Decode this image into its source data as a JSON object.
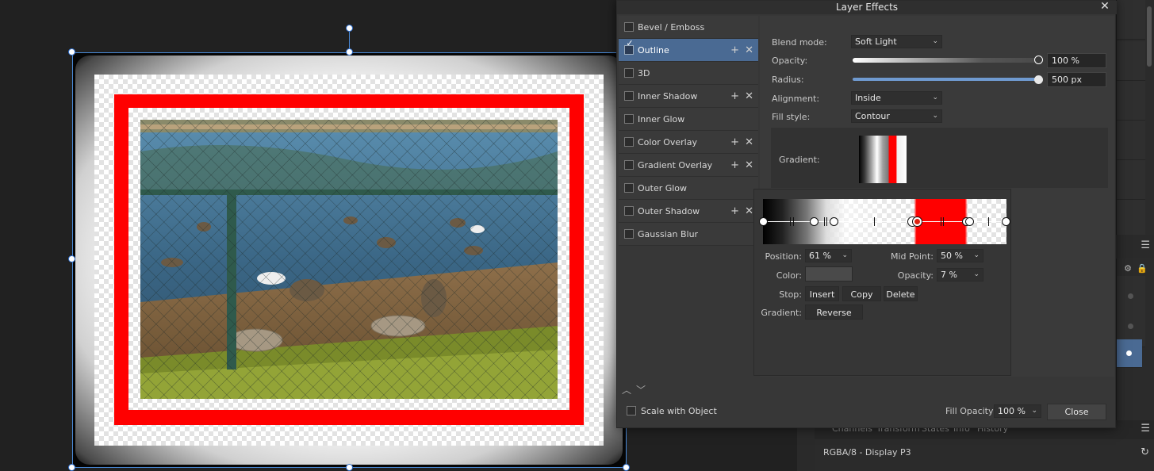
{
  "dialog": {
    "title": "Layer Effects",
    "close_glyph": "✕"
  },
  "effects": [
    {
      "label": "Bevel / Emboss",
      "checked": false,
      "selected": false,
      "has_controls": false
    },
    {
      "label": "Outline",
      "checked": true,
      "selected": true,
      "has_controls": true
    },
    {
      "label": "3D",
      "checked": false,
      "selected": false,
      "has_controls": false
    },
    {
      "label": "Inner Shadow",
      "checked": false,
      "selected": false,
      "has_controls": true
    },
    {
      "label": "Inner Glow",
      "checked": false,
      "selected": false,
      "has_controls": false
    },
    {
      "label": "Color Overlay",
      "checked": false,
      "selected": false,
      "has_controls": true
    },
    {
      "label": "Gradient Overlay",
      "checked": false,
      "selected": false,
      "has_controls": true
    },
    {
      "label": "Outer Glow",
      "checked": false,
      "selected": false,
      "has_controls": false
    },
    {
      "label": "Outer Shadow",
      "checked": false,
      "selected": false,
      "has_controls": true
    },
    {
      "label": "Gaussian Blur",
      "checked": false,
      "selected": false,
      "has_controls": false
    }
  ],
  "settings": {
    "blend_mode_label": "Blend mode:",
    "blend_mode_value": "Soft Light",
    "opacity_label": "Opacity:",
    "opacity_value": "100 %",
    "opacity_level": 1.0,
    "radius_label": "Radius:",
    "radius_value": "500 px",
    "radius_level": 1.0,
    "alignment_label": "Alignment:",
    "alignment_value": "Inside",
    "fill_style_label": "Fill style:",
    "fill_style_value": "Contour",
    "gradient_label": "Gradient:"
  },
  "gradient_editor": {
    "position_label": "Position:",
    "position_value": "61 %",
    "midpoint_label": "Mid Point:",
    "midpoint_value": "50 %",
    "color_label": "Color:",
    "opacity_label": "Opacity:",
    "opacity_value": "7 %",
    "stop_label": "Stop:",
    "insert_label": "Insert",
    "copy_label": "Copy",
    "delete_label": "Delete",
    "gradient_label": "Gradient:",
    "reverse_label": "Reverse"
  },
  "footer": {
    "scale_label": "Scale with Object",
    "fill_opacity_label": "Fill Opacity:",
    "fill_opacity_value": "100 %",
    "close_label": "Close"
  },
  "channels": {
    "tabs": [
      "Channels",
      "Transform",
      "States",
      "Info",
      "History"
    ],
    "color_format": "RGBA/8 - Display P3"
  },
  "colors": {
    "accent": "#4a6a93",
    "outline_red": "#ff0000",
    "dialog_bg": "#373737"
  }
}
